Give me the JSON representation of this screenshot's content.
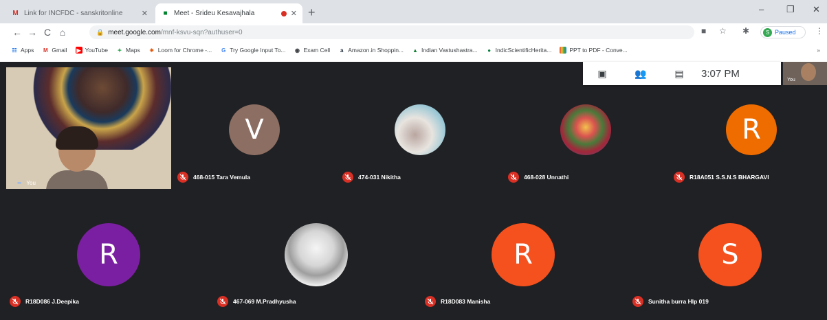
{
  "browser": {
    "tabs": [
      {
        "favicon": "gmail-icon",
        "title": "Link for INCFDC - sanskritonline",
        "active": false
      },
      {
        "favicon": "meet-icon",
        "title": "Meet - Srideu Kesavajhala",
        "active": true
      }
    ],
    "new_tab": "+",
    "window": {
      "minimize": "–",
      "restore": "❐",
      "close": "✕"
    },
    "nav": {
      "back": "←",
      "forward": "→",
      "reload": "C",
      "home": "⌂"
    },
    "url_host": "meet.google.com",
    "url_path": "/mnf-ksvu-sqn?authuser=0",
    "profile_initial": "S",
    "profile_status": "Paused",
    "bookmarks": [
      {
        "icon": "apps-icon",
        "label": "Apps"
      },
      {
        "icon": "gmail-icon",
        "label": "Gmail"
      },
      {
        "icon": "youtube-icon",
        "label": "YouTube"
      },
      {
        "icon": "maps-icon",
        "label": "Maps"
      },
      {
        "icon": "loom-icon",
        "label": "Loom for Chrome -..."
      },
      {
        "icon": "google-icon",
        "label": "Try Google Input To..."
      },
      {
        "icon": "globe-icon",
        "label": "Exam Cell"
      },
      {
        "icon": "amazon-icon",
        "label": "Amazon.in Shoppin..."
      },
      {
        "icon": "drive-icon",
        "label": "Indian Vastushastra..."
      },
      {
        "icon": "circle-icon",
        "label": "IndicScientificHerita..."
      },
      {
        "icon": "pdf-icon",
        "label": "PPT to PDF - Conve..."
      }
    ]
  },
  "meet": {
    "time": "3:07 PM",
    "self_label": "You",
    "pip_label": "You",
    "participants": [
      {
        "name": "468-015 Tara Vemula",
        "initial": "V",
        "color": "#8d6e63",
        "kind": "letter"
      },
      {
        "name": "474-031 Nikitha",
        "initial": "",
        "color": "#cfd8dc",
        "kind": "photo"
      },
      {
        "name": "468-028 Unnathi",
        "initial": "",
        "color": "#7b1f2a",
        "kind": "photo"
      },
      {
        "name": "R18A051 S.S.N.S BHARGAVI",
        "initial": "R",
        "color": "#ef6c00",
        "kind": "letter"
      },
      {
        "name": "R18D086 J.Deepika",
        "initial": "R",
        "color": "#7b1fa2",
        "kind": "letter"
      },
      {
        "name": "467-069 M.Pradhyusha",
        "initial": "",
        "color": "#eeeeee",
        "kind": "photo"
      },
      {
        "name": "R18D083 Manisha",
        "initial": "R",
        "color": "#f4511e",
        "kind": "letter"
      },
      {
        "name": "Sunitha burra Hlp 019",
        "initial": "S",
        "color": "#f4511e",
        "kind": "letter"
      }
    ]
  }
}
